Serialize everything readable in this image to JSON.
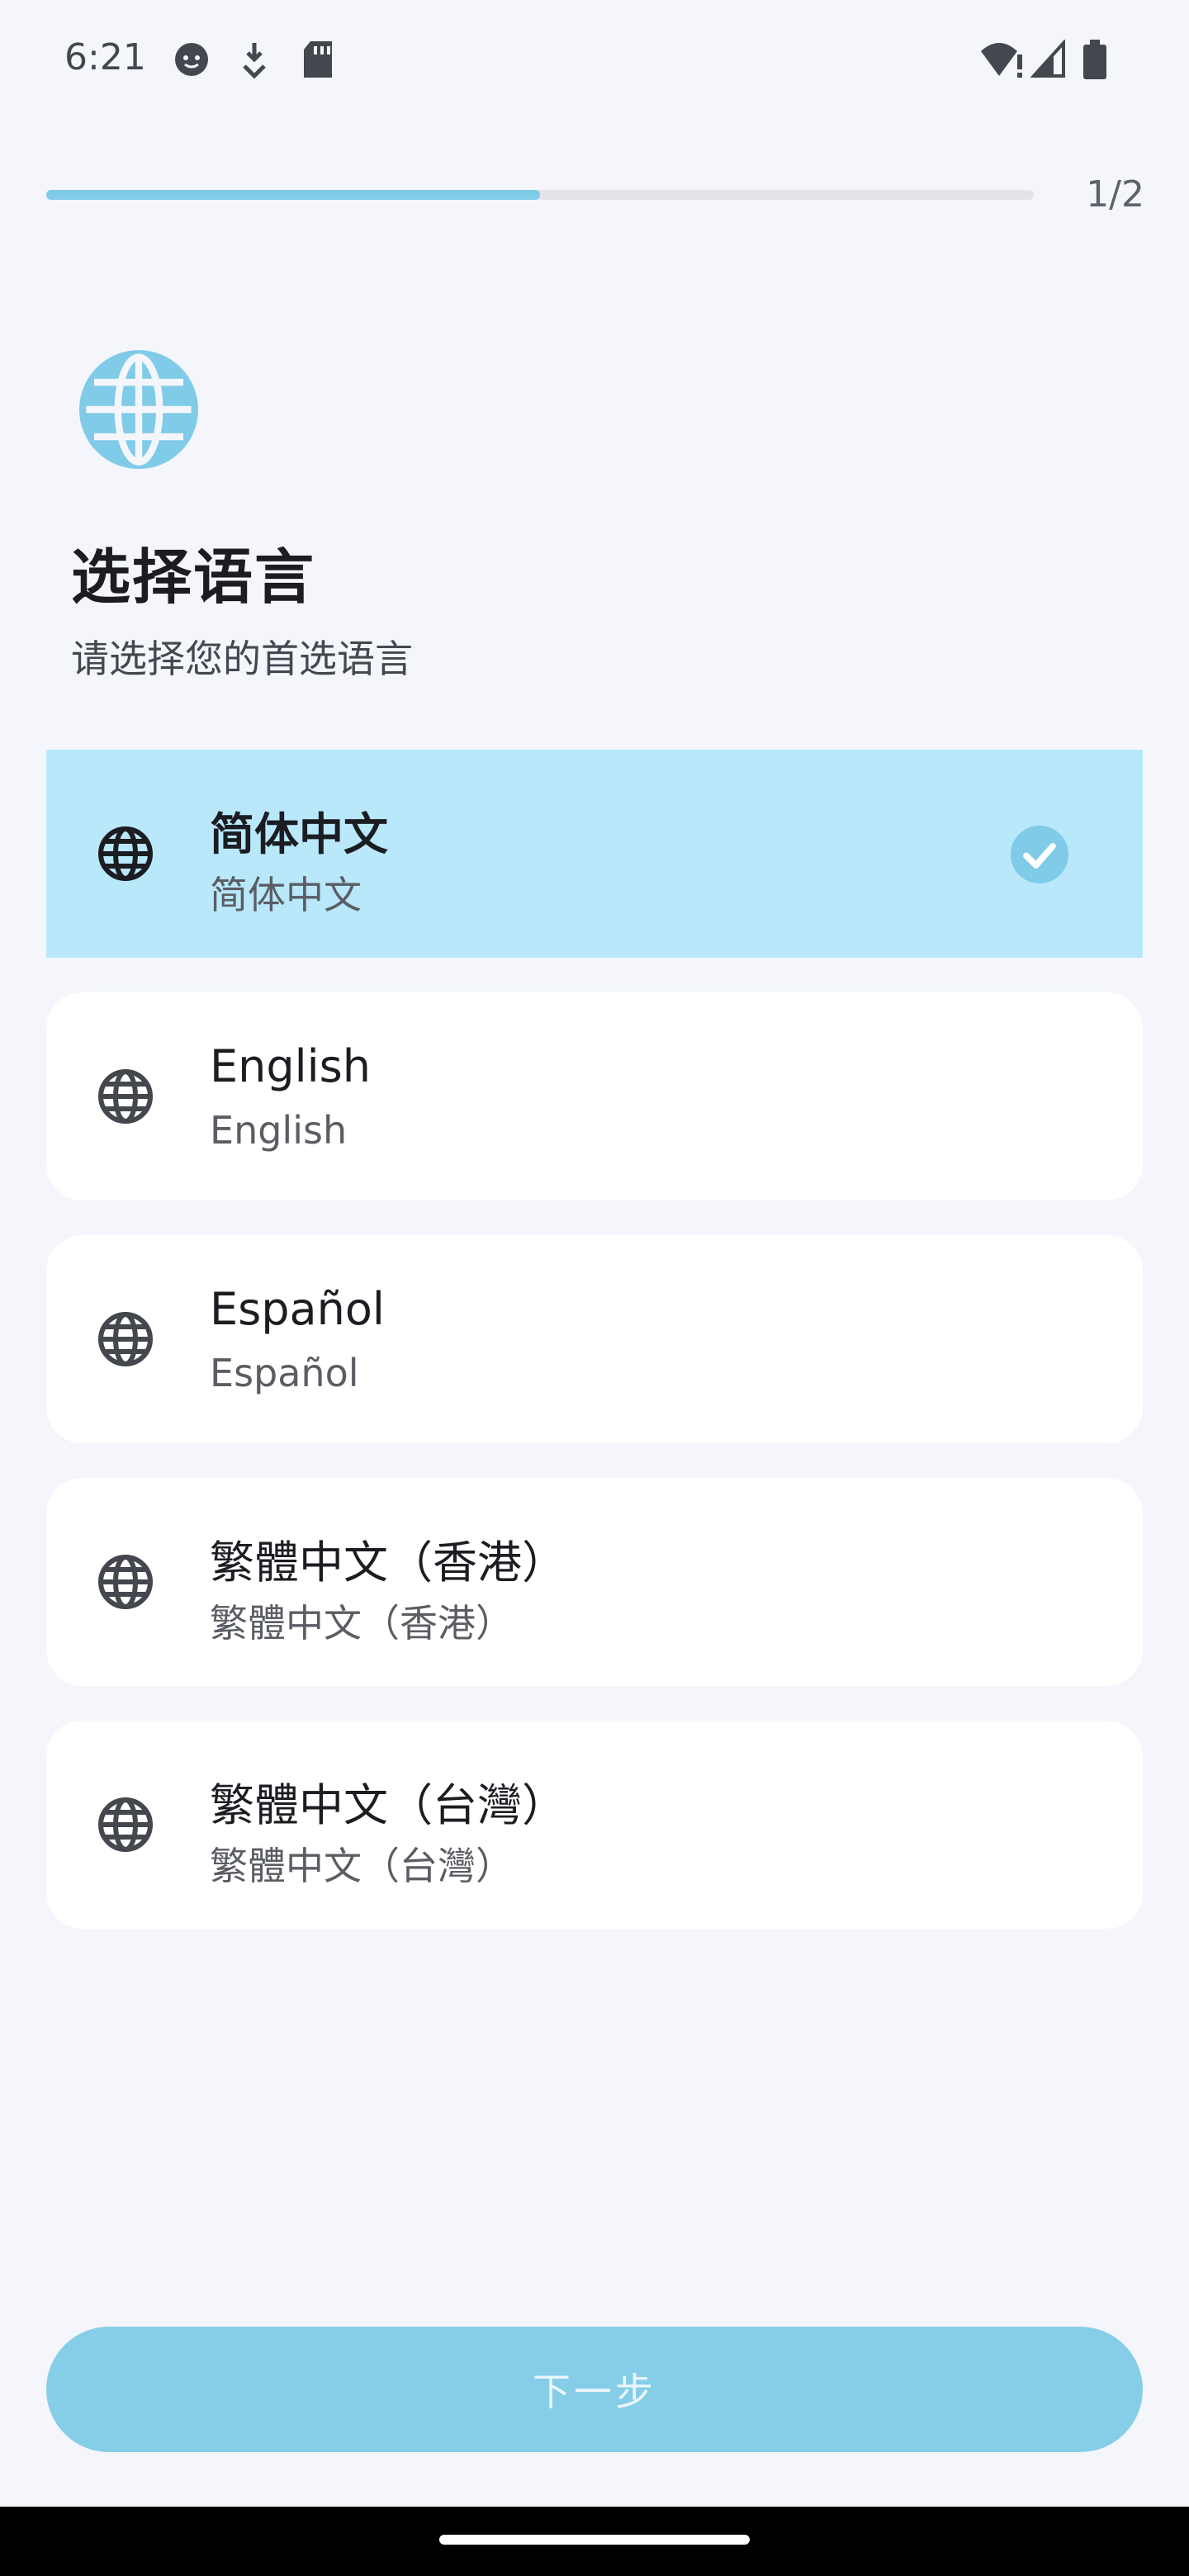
{
  "status_bar": {
    "time": "6:21",
    "icons": [
      "face-notification-icon",
      "download-icon",
      "sd-card-icon",
      "wifi-alert-icon",
      "signal-icon",
      "battery-icon"
    ]
  },
  "progress": {
    "fraction": 0.5,
    "label": "1/2"
  },
  "header": {
    "icon": "globe-icon",
    "title": "选择语言",
    "subtitle": "请选择您的首选语言"
  },
  "languages": [
    {
      "name": "简体中文",
      "native": "简体中文",
      "selected": true
    },
    {
      "name": "English",
      "native": "English",
      "selected": false
    },
    {
      "name": "Español",
      "native": "Español",
      "selected": false
    },
    {
      "name": "繁體中文（香港）",
      "native": "繁體中文（香港）",
      "selected": false
    },
    {
      "name": "繁體中文（台灣）",
      "native": "繁體中文（台灣）",
      "selected": false
    }
  ],
  "next_button": {
    "label": "下一步"
  },
  "colors": {
    "accent": "#7FCBE8",
    "selected_bg": "#B9E8FB",
    "background": "#F4F6FC"
  }
}
